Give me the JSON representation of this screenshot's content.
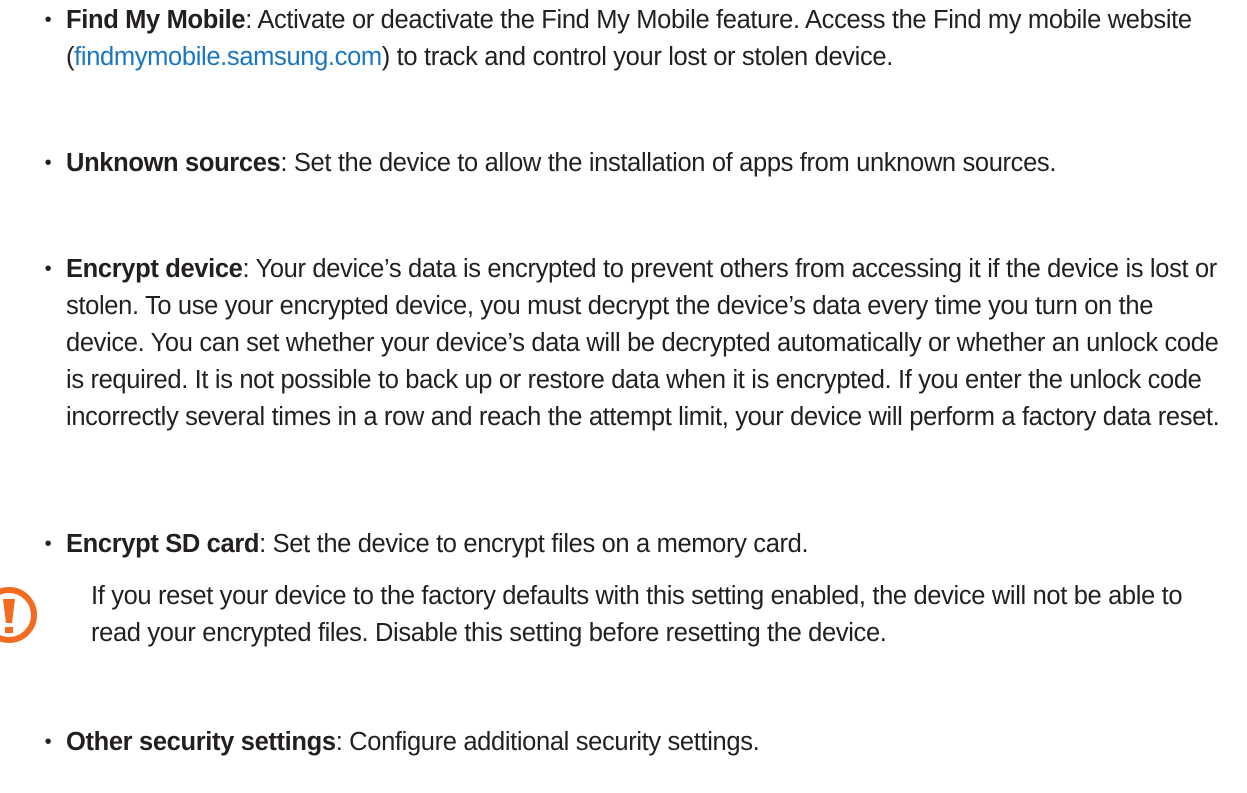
{
  "bullet_char": "•",
  "items": [
    {
      "term": "Find My Mobile",
      "before_link": ": Activate or deactivate the Find My Mobile feature. Access the Find my mobile website (",
      "link": "findmymobile.samsung.com",
      "after_link": ") to track and control your lost or stolen device."
    },
    {
      "term": "Unknown sources",
      "desc": ": Set the device to allow the installation of apps from unknown sources."
    },
    {
      "term": "Encrypt device",
      "desc": ": Your device’s data is encrypted to prevent others from accessing it if the device is lost or stolen. To use your encrypted device, you must decrypt the device’s data every time you turn on the device. You can set whether your device’s data will be decrypted automatically or whether an unlock code is required. It is not possible to back up or restore data when it is encrypted. If you enter the unlock code incorrectly several times in a row and reach the attempt limit, your device will perform a factory data reset."
    },
    {
      "term": "Encrypt SD card",
      "desc": ": Set the device to encrypt files on a memory card."
    },
    {
      "term": "Other security settings",
      "desc": ": Configure additional security settings."
    }
  ],
  "note": {
    "icon": "caution-icon",
    "icon_color": "#f26b21",
    "text": "If you reset your device to the factory defaults with this setting enabled, the device will not be able to read your encrypted files. Disable this setting before resetting the device."
  },
  "colors": {
    "text": "#231f20",
    "link": "#1a76c2",
    "caution": "#f26b21"
  }
}
